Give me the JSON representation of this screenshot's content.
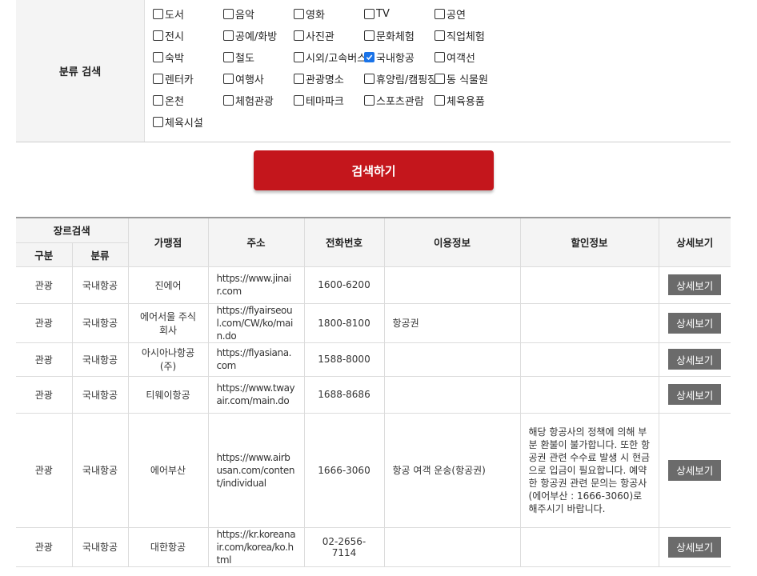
{
  "filter": {
    "label": "분류 검색",
    "rows": [
      [
        {
          "label": "도서",
          "checked": false
        },
        {
          "label": "음악",
          "checked": false
        },
        {
          "label": "영화",
          "checked": false
        },
        {
          "label": "TV",
          "checked": false
        },
        {
          "label": "공연",
          "checked": false
        }
      ],
      [
        {
          "label": "전시",
          "checked": false
        },
        {
          "label": "공예/화방",
          "checked": false
        },
        {
          "label": "사진관",
          "checked": false
        },
        {
          "label": "문화체험",
          "checked": false
        },
        {
          "label": "직업체험",
          "checked": false
        }
      ],
      [
        {
          "label": "숙박",
          "checked": false
        },
        {
          "label": "철도",
          "checked": false
        },
        {
          "label": "시외/고속버스",
          "checked": false
        },
        {
          "label": "국내항공",
          "checked": true
        },
        {
          "label": "여객선",
          "checked": false
        }
      ],
      [
        {
          "label": "렌터카",
          "checked": false
        },
        {
          "label": "여행사",
          "checked": false
        },
        {
          "label": "관광명소",
          "checked": false
        },
        {
          "label": "휴양림/캠핑장",
          "checked": false
        },
        {
          "label": "동 식물원",
          "checked": false
        }
      ],
      [
        {
          "label": "온천",
          "checked": false
        },
        {
          "label": "체험관광",
          "checked": false
        },
        {
          "label": "테마파크",
          "checked": false
        },
        {
          "label": "스포츠관람",
          "checked": false
        },
        {
          "label": "체육용품",
          "checked": false
        }
      ],
      [
        {
          "label": "체육시설",
          "checked": false
        }
      ]
    ]
  },
  "search_button": "검색하기",
  "table": {
    "headers": {
      "genre_search": "장르검색",
      "category_group": "구분",
      "category": "분류",
      "store": "가맹점",
      "address": "주소",
      "phone": "전화번호",
      "usage_info": "이용정보",
      "discount_info": "할인정보",
      "details": "상세보기"
    },
    "detail_label": "상세보기",
    "rows": [
      {
        "group": "관광",
        "category": "국내항공",
        "store": "진에어",
        "address": "https://www.jinair.com",
        "phone": "1600-6200",
        "usage": "",
        "discount": ""
      },
      {
        "group": "관광",
        "category": "국내항공",
        "store": "에어서울 주식회사",
        "address": "https://flyairseoul.com/CW/ko/main.do",
        "phone": "1800-8100",
        "usage": "항공권",
        "discount": ""
      },
      {
        "group": "관광",
        "category": "국내항공",
        "store": "아시아나항공(주)",
        "address": "https://flyasiana.com",
        "phone": "1588-8000",
        "usage": "",
        "discount": ""
      },
      {
        "group": "관광",
        "category": "국내항공",
        "store": "티웨이항공",
        "address": "https://www.twayair.com/main.do",
        "phone": "1688-8686",
        "usage": "",
        "discount": ""
      },
      {
        "group": "관광",
        "category": "국내항공",
        "store": "에어부산",
        "address": "https://www.airbusan.com/content/individual",
        "phone": "1666-3060",
        "usage": "항공 여객 운송(항공권)",
        "discount": "해당 항공사의 정책에 의해 부분 환불이 불가합니다. 또한 항공권 관련 수수료 발생 시 현금으로 입금이 필요합니다. 예약한 항공권 관련 문의는 항공사(에어부산 : 1666-3060)로 해주시기 바랍니다."
      },
      {
        "group": "관광",
        "category": "국내항공",
        "store": "대한항공",
        "address": "https://kr.koreanair.com/korea/ko.html",
        "phone": "02-2656-7114",
        "usage": "",
        "discount": ""
      }
    ]
  },
  "colors": {
    "accent": "#c4161c",
    "detail_button": "#6b6b6b",
    "checkbox_checked": "#1a73e8"
  }
}
